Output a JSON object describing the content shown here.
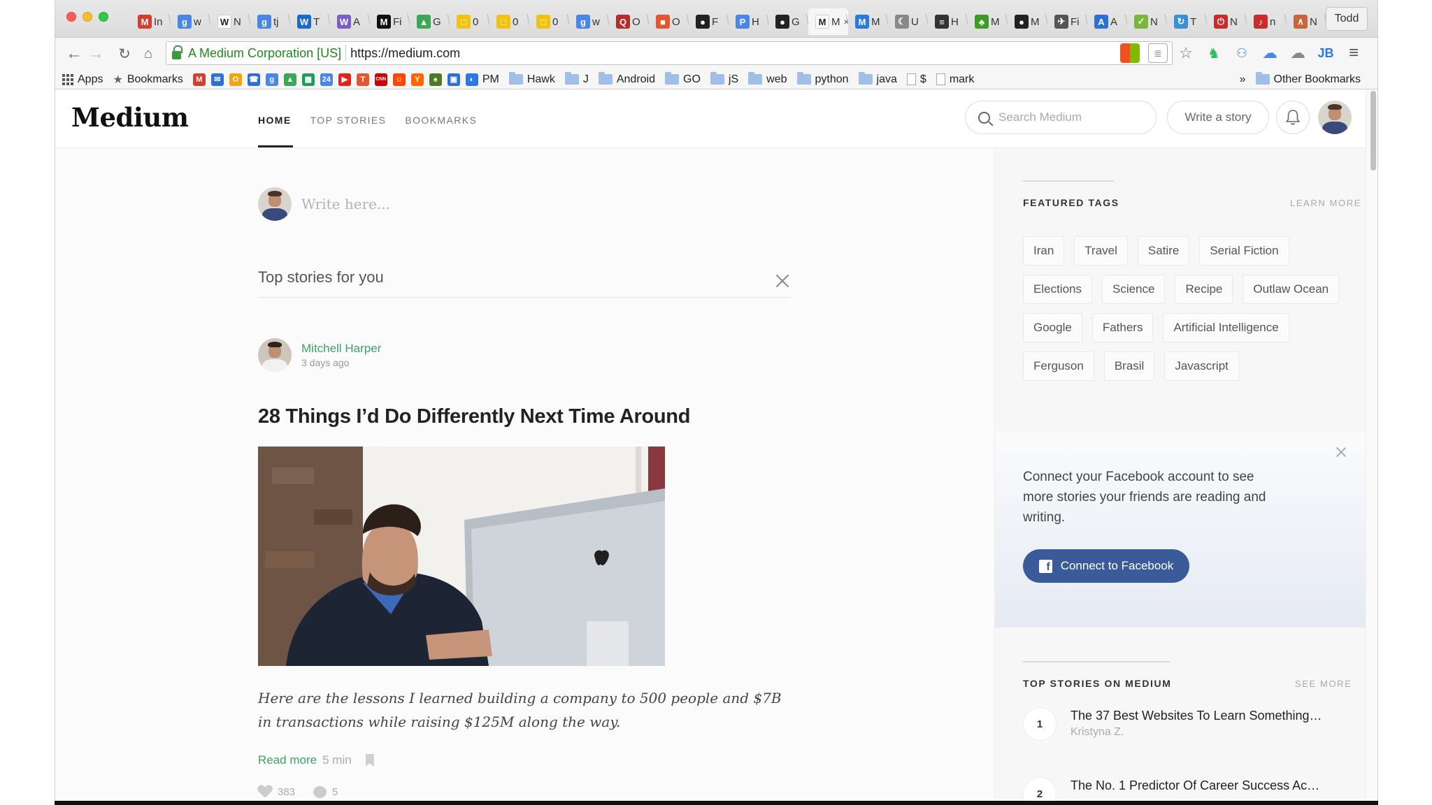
{
  "browser": {
    "tabs": [
      {
        "icon": "gmail-icon",
        "label": "In",
        "color": "#d23f31",
        "glyph": "M"
      },
      {
        "icon": "google-icon",
        "label": "w",
        "color": "#4a86e8",
        "glyph": "g"
      },
      {
        "icon": "wikipedia-icon",
        "label": "N",
        "color": "#ffffff",
        "glyph": "W"
      },
      {
        "icon": "google-icon",
        "label": "tj",
        "color": "#4a86e8",
        "glyph": "g"
      },
      {
        "icon": "wikipedia-icon",
        "label": "T",
        "color": "#1b6ac9",
        "glyph": "W"
      },
      {
        "icon": "wikipedia-icon",
        "label": "A",
        "color": "#7d5ec9",
        "glyph": "W"
      },
      {
        "icon": "medium-icon",
        "label": "Fi",
        "color": "#111111",
        "glyph": "M"
      },
      {
        "icon": "drive-icon",
        "label": "G",
        "color": "#3ea756",
        "glyph": "▲"
      },
      {
        "icon": "slides-icon",
        "label": "0",
        "color": "#f4c20d",
        "glyph": "□"
      },
      {
        "icon": "slides-icon",
        "label": "0",
        "color": "#f4c20d",
        "glyph": "□"
      },
      {
        "icon": "slides-icon",
        "label": "0",
        "color": "#f4c20d",
        "glyph": "□"
      },
      {
        "icon": "google-icon",
        "label": "w",
        "color": "#4a86e8",
        "glyph": "g"
      },
      {
        "icon": "quora-icon",
        "label": "O",
        "color": "#b92b27",
        "glyph": "Q"
      },
      {
        "icon": "office-icon",
        "label": "O",
        "color": "#e4572e",
        "glyph": "■"
      },
      {
        "icon": "github-icon",
        "label": "F",
        "color": "#222222",
        "glyph": "●"
      },
      {
        "icon": "producthunt-icon",
        "label": "H",
        "color": "#4a86e8",
        "glyph": "P"
      },
      {
        "icon": "github-icon",
        "label": "G",
        "color": "#222222",
        "glyph": "●"
      },
      {
        "icon": "medium-icon",
        "label": "M",
        "color": "#ffffff",
        "glyph": "M",
        "active": true
      },
      {
        "icon": "medium-icon",
        "label": "M",
        "color": "#2a7ae2",
        "glyph": "M"
      },
      {
        "icon": "moon-icon",
        "label": "U",
        "color": "#888888",
        "glyph": "☾"
      },
      {
        "icon": "menu-icon",
        "label": "H",
        "color": "#333333",
        "glyph": "≡"
      },
      {
        "icon": "leaf-icon",
        "label": "M",
        "color": "#3a9d23",
        "glyph": "♣"
      },
      {
        "icon": "github-icon",
        "label": "M",
        "color": "#222222",
        "glyph": "●"
      },
      {
        "icon": "plane-icon",
        "label": "Fi",
        "color": "#555555",
        "glyph": "✈"
      },
      {
        "icon": "app-icon",
        "label": "A",
        "color": "#2f6fd8",
        "glyph": "A"
      },
      {
        "icon": "check-icon",
        "label": "N",
        "color": "#7bb63b",
        "glyph": "✓"
      },
      {
        "icon": "swirl-icon",
        "label": "T",
        "color": "#3a8fd8",
        "glyph": "↻"
      },
      {
        "icon": "power-icon",
        "label": "N",
        "color": "#cc2b2b",
        "glyph": "⏻"
      },
      {
        "icon": "music-icon",
        "label": "n",
        "color": "#cc2b2b",
        "glyph": "♪"
      },
      {
        "icon": "chart-icon",
        "label": "N",
        "color": "#c7663b",
        "glyph": "∧"
      }
    ],
    "active_tab_close": "×",
    "profile_name": "Todd",
    "url_org": "A Medium Corporation [US]",
    "url": "https://medium.com",
    "bookmarks": [
      {
        "label": "Apps",
        "kind": "apps"
      },
      {
        "label": "Bookmarks",
        "kind": "star"
      },
      {
        "label": "",
        "kind": "icon",
        "color": "#d23f31",
        "glyph": "M"
      },
      {
        "label": "",
        "kind": "icon",
        "color": "#2f6fd8",
        "glyph": "✉"
      },
      {
        "label": "",
        "kind": "icon",
        "color": "#f4a20d",
        "glyph": "O"
      },
      {
        "label": "",
        "kind": "icon",
        "color": "#2f6fd8",
        "glyph": "☎"
      },
      {
        "label": "",
        "kind": "icon",
        "color": "#4a86e8",
        "glyph": "g"
      },
      {
        "label": "",
        "kind": "icon",
        "color": "#3ea756",
        "glyph": "▲"
      },
      {
        "label": "",
        "kind": "icon",
        "color": "#1f9d55",
        "glyph": "▦"
      },
      {
        "label": "",
        "kind": "icon",
        "color": "#4a86e8",
        "glyph": "24"
      },
      {
        "label": "",
        "kind": "icon",
        "color": "#e62117",
        "glyph": "▶"
      },
      {
        "label": "",
        "kind": "icon",
        "color": "#e4572e",
        "glyph": "T"
      },
      {
        "label": "",
        "kind": "icon",
        "color": "#cc0000",
        "glyph": "CNN"
      },
      {
        "label": "",
        "kind": "icon",
        "color": "#ff4500",
        "glyph": "☺"
      },
      {
        "label": "",
        "kind": "icon",
        "color": "#ff6600",
        "glyph": "Y"
      },
      {
        "label": "",
        "kind": "icon",
        "color": "#4c7a22",
        "glyph": "♠"
      },
      {
        "label": "",
        "kind": "icon",
        "color": "#2f6fd8",
        "glyph": "▣"
      },
      {
        "label": "PM",
        "kind": "icon",
        "color": "#2a7ae2",
        "glyph": "◐"
      },
      {
        "label": "Hawk",
        "kind": "folder"
      },
      {
        "label": "J",
        "kind": "folder"
      },
      {
        "label": "Android",
        "kind": "folder"
      },
      {
        "label": "GO",
        "kind": "folder"
      },
      {
        "label": "jS",
        "kind": "folder"
      },
      {
        "label": "web",
        "kind": "folder"
      },
      {
        "label": "python",
        "kind": "folder"
      },
      {
        "label": "java",
        "kind": "folder"
      },
      {
        "label": "$",
        "kind": "page"
      },
      {
        "label": "mark",
        "kind": "page"
      }
    ],
    "bookmarks_overflow": "»",
    "other_bookmarks": "Other Bookmarks"
  },
  "header": {
    "logo": "Medium",
    "nav": [
      "HOME",
      "TOP STORIES",
      "BOOKMARKS"
    ],
    "search_placeholder": "Search Medium",
    "write_button": "Write a story"
  },
  "composer": {
    "placeholder": "Write here..."
  },
  "feed": {
    "section_title": "Top stories for you",
    "post": {
      "author": "Mitchell Harper",
      "time": "3 days ago",
      "title": "28 Things I’d Do Differently Next Time Around",
      "excerpt": "Here are the lessons I learned building a company to 500 people and $7B in transactions while raising $125M along the way.",
      "read_more": "Read more",
      "read_time": "5 min",
      "likes": "383",
      "comments": "5"
    }
  },
  "sidebar": {
    "featured_title": "FEATURED TAGS",
    "learn_more": "LEARN MORE",
    "tags": [
      "Iran",
      "Travel",
      "Satire",
      "Serial Fiction",
      "Elections",
      "Science",
      "Recipe",
      "Outlaw Ocean",
      "Google",
      "Fathers",
      "Artificial Intelligence",
      "Ferguson",
      "Brasil",
      "Javascript"
    ],
    "facebook": {
      "text": "Connect your Facebook account to see more stories your friends are reading and writing.",
      "button": "Connect to Facebook",
      "brand_color": "#3b5a9a"
    },
    "top_title": "TOP STORIES ON MEDIUM",
    "see_more": "SEE MORE",
    "top_stories": [
      {
        "rank": "1",
        "title": "The 37 Best Websites To Learn Something N...",
        "author": "Kristyna Z."
      },
      {
        "rank": "2",
        "title": "The No. 1 Predictor Of Career Success Accor...",
        "author": ""
      }
    ]
  },
  "colors": {
    "accent_green": "#3fa06a",
    "text_dark": "#222222",
    "muted": "#aaaaaa"
  }
}
